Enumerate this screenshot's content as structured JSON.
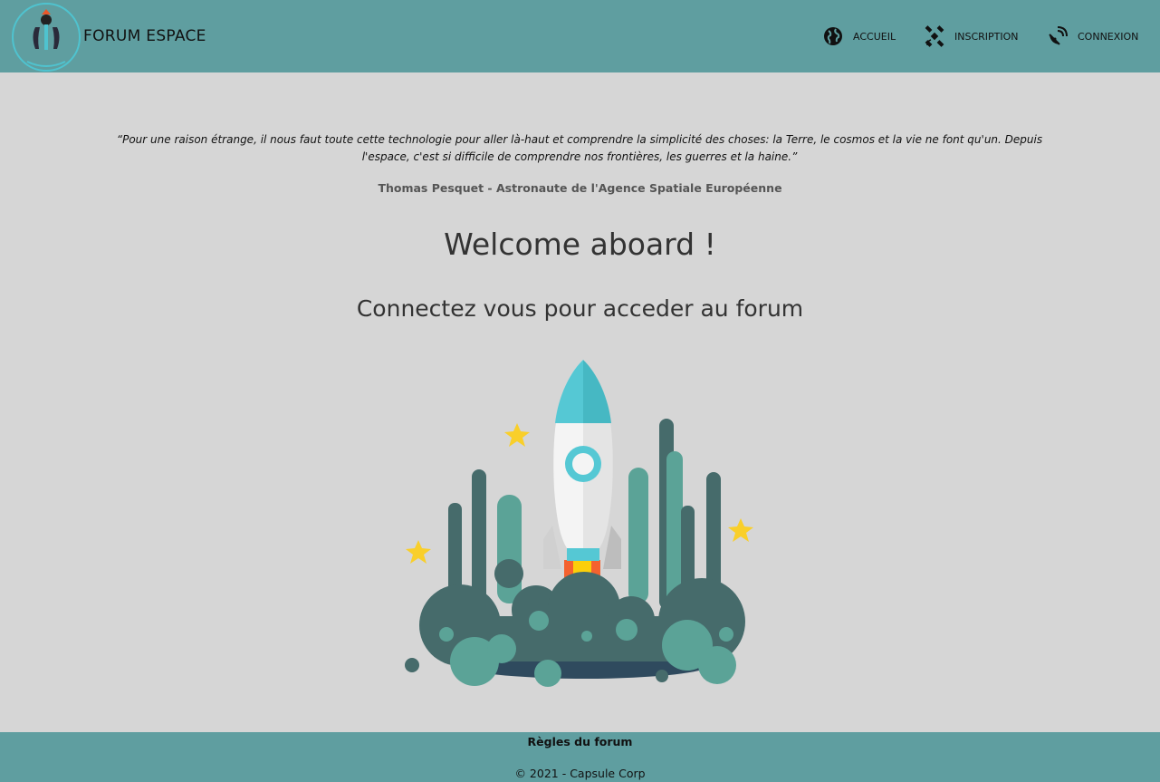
{
  "header": {
    "brand": "FORUM ESPACE",
    "nav": [
      {
        "label": "ACCUEIL",
        "icon": "globe-icon"
      },
      {
        "label": "INSCRIPTION",
        "icon": "satellite-icon"
      },
      {
        "label": "CONNEXION",
        "icon": "satellite-dish-icon"
      }
    ]
  },
  "main": {
    "quote": "“Pour une raison étrange, il nous faut toute cette technologie pour aller là-haut et comprendre la simplicité des choses: la Terre, le cosmos et la vie ne font qu'un. Depuis l'espace, c'est si difficile de comprendre nos frontières, les guerres et la haine.”",
    "author": "Thomas Pesquet - Astronaute de l'Agence Spatiale Européenne",
    "welcome": "Welcome aboard !",
    "subtitle": "Connectez vous pour acceder au forum"
  },
  "footer": {
    "rules": "Règles du forum",
    "copyright": "© 2021 - Capsule Corp"
  },
  "colors": {
    "header_bg": "#5f9ea0",
    "page_bg": "#d6d6d6",
    "rocket_teal": "#4fc3cf",
    "smoke_dark": "#466b6b",
    "smoke_light": "#5ba397",
    "star": "#f9cf2a"
  }
}
